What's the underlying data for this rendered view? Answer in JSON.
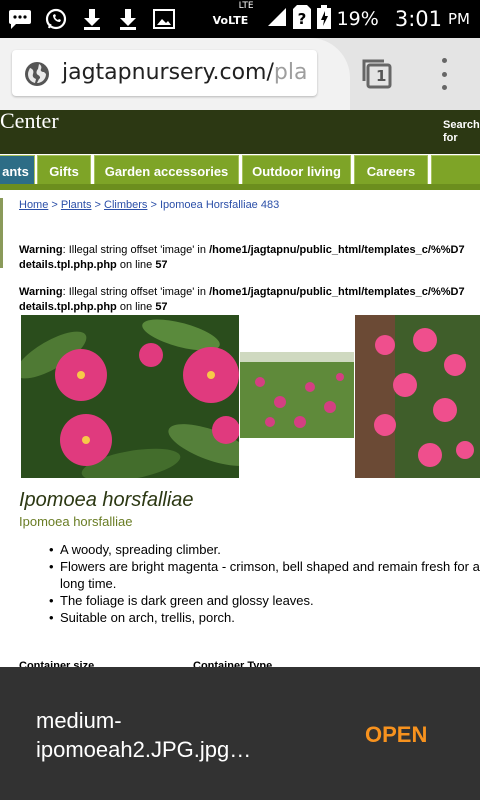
{
  "status_bar": {
    "volte": "VoLTE",
    "lte": "LTE",
    "battery_percent": "19%",
    "time": "3:01",
    "ampm": "PM"
  },
  "browser": {
    "url_main": "jagtapnursery.com/",
    "url_rest": "pla",
    "tab_count": "1"
  },
  "site": {
    "title": "Center",
    "search_label_line1": "Search",
    "search_label_line2": "for",
    "nav": [
      {
        "label": "ants"
      },
      {
        "label": "Gifts"
      },
      {
        "label": "Garden accessories"
      },
      {
        "label": "Outdoor living"
      },
      {
        "label": "Careers"
      }
    ]
  },
  "breadcrumb": {
    "home": "Home",
    "sep": " > ",
    "plants": "Plants",
    "climbers": "Climbers",
    "current": "Ipomoea Horsfalliae 483"
  },
  "warnings": [
    {
      "prefix": "Warning",
      "message": ": Illegal string offset 'image' in ",
      "path": "/home1/jagtapnu/public_html/templates_c/%%D7",
      "path2": "details.tpl.php.php",
      "on_line": " on line ",
      "line": "57"
    },
    {
      "prefix": "Warning",
      "message": ": Illegal string offset 'image' in ",
      "path": "/home1/jagtapnu/public_html/templates_c/%%D7",
      "path2": "details.tpl.php.php",
      "on_line": " on line ",
      "line": "57"
    }
  ],
  "product": {
    "title": "Ipomoea horsfalliae",
    "subtitle": "Ipomoea horsfalliae",
    "bullets": [
      "A woody, spreading climber.",
      "Flowers are bright magenta - crimson, bell shaped and remain fresh for a long time.",
      "The foliage is dark green and glossy leaves.",
      "Suitable on arch, trellis, porch."
    ],
    "table_headers": [
      "Container size",
      "Container Type"
    ]
  },
  "download": {
    "filename": "medium-ipomoeah2.JPG.jpg…",
    "action": "OPEN"
  },
  "colors": {
    "header_bg": "#2c3813",
    "nav_green": "#7ea427",
    "nav_active": "#2d6d86",
    "link": "#2b4fa8",
    "open_orange": "#f7921e"
  }
}
